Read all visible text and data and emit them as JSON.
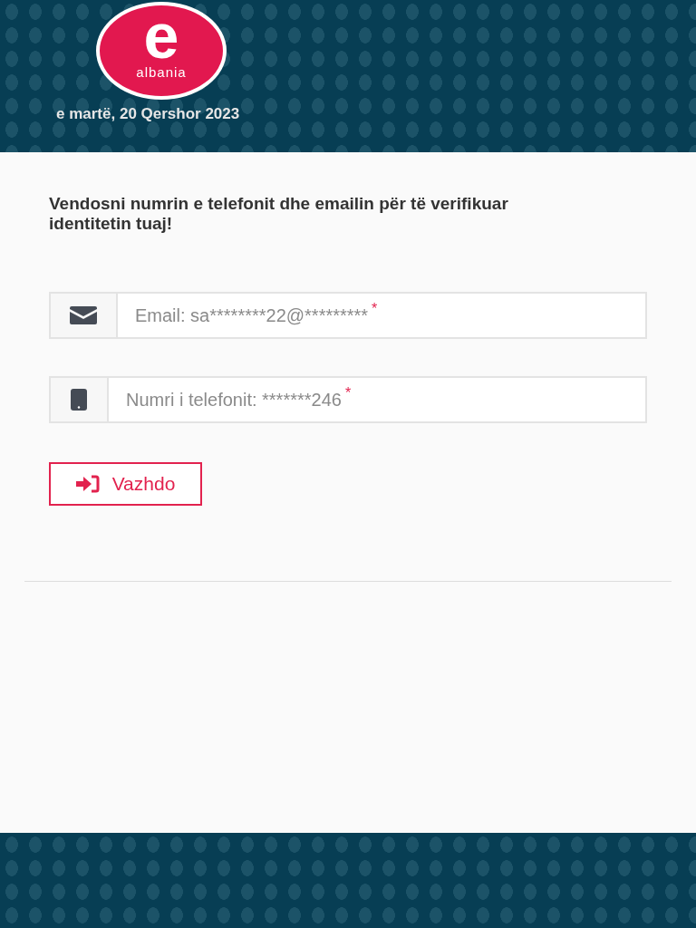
{
  "header": {
    "logo": {
      "letter": "e",
      "word": "albania"
    },
    "date": "e martë, 20 Qershor 2023"
  },
  "heading": "Vendosni numrin e telefonit dhe emailin për të verifikuar identitetin tuaj!",
  "fields": [
    {
      "kind": "email",
      "placeholder": "Email: sa********22@*********",
      "required_mark": "*"
    },
    {
      "kind": "phone",
      "placeholder": "Numri i telefonit: *******246",
      "required_mark": "*"
    }
  ],
  "button": {
    "label": "Vazhdo"
  }
}
